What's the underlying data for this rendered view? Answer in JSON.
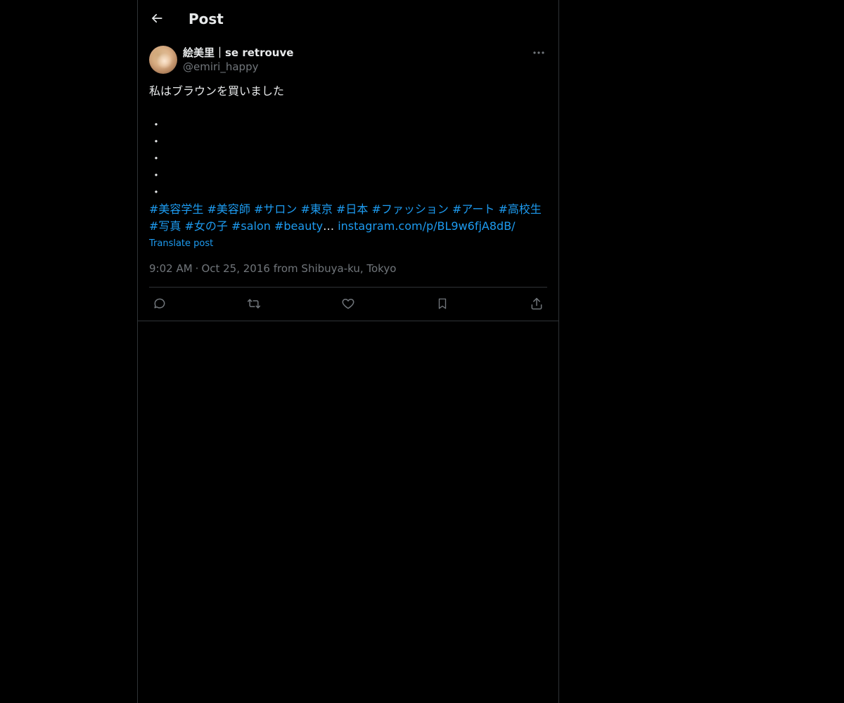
{
  "colors": {
    "background": "#000000",
    "text": "#e7e9ea",
    "secondary": "#71767b",
    "accent": "#1d9bf0",
    "border": "#2f3336"
  },
  "header": {
    "title": "Post",
    "back_icon": "arrow-left-icon"
  },
  "author": {
    "display_name": "絵美里｜se retrouve",
    "handle": "@emiri_happy",
    "more_icon": "more-horizontal-icon"
  },
  "post": {
    "text": "私はブラウンを買いました",
    "dots": [
      "・",
      "・",
      "・",
      "・",
      "・"
    ],
    "hashtags_line": "#美容学生 #美容師 #サロン #東京 #日本 #ファッション #アート #高校生 #写真 #女の子 #salon #beauty",
    "ellipsis": "…",
    "link": "instagram.com/p/BL9w6fjA8dB/",
    "translate_label": "Translate post"
  },
  "meta": {
    "time": "9:02 AM",
    "separator": "·",
    "date": "Oct 25, 2016",
    "from_label": "from",
    "location": "Shibuya-ku, Tokyo"
  },
  "actions": [
    {
      "name": "reply",
      "icon": "reply-icon"
    },
    {
      "name": "repost",
      "icon": "repost-icon"
    },
    {
      "name": "like",
      "icon": "heart-icon"
    },
    {
      "name": "bookmark",
      "icon": "bookmark-icon"
    },
    {
      "name": "share",
      "icon": "share-icon"
    }
  ]
}
